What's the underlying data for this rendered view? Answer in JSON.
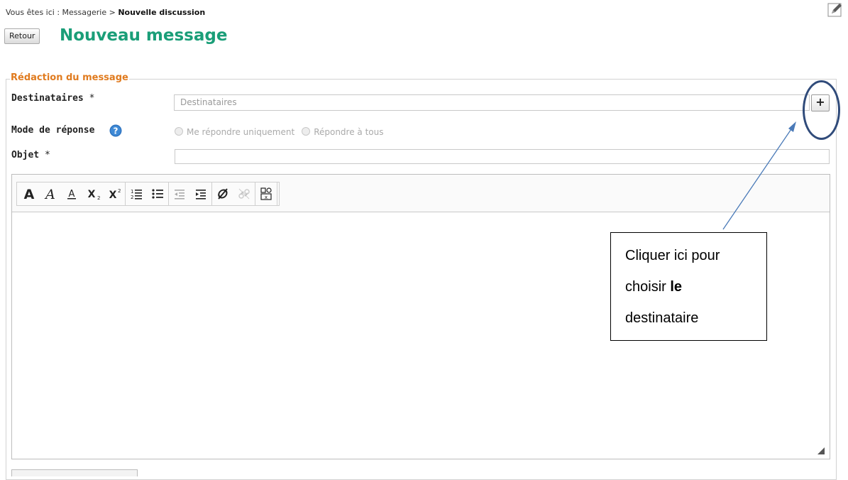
{
  "breadcrumb": {
    "prefix": "Vous êtes ici : Messagerie > ",
    "current": "Nouvelle discussion"
  },
  "header": {
    "back_label": "Retour",
    "title": "Nouveau message"
  },
  "form": {
    "legend": "Rédaction du message",
    "recipients": {
      "label": "Destinataires",
      "required": "*",
      "placeholder": "Destinataires",
      "add_label": "+"
    },
    "reply_mode": {
      "label": "Mode de réponse",
      "options": [
        "Me répondre uniquement",
        "Répondre à tous"
      ]
    },
    "subject": {
      "label": "Objet",
      "required": "*",
      "value": ""
    }
  },
  "editor": {
    "toolbar": [
      "bold",
      "italic",
      "underline",
      "subscript",
      "superscript",
      "ordered-list",
      "unordered-list",
      "outdent",
      "indent",
      "remove-format",
      "unlink",
      "insert-field"
    ]
  },
  "callout": {
    "line1": "Cliquer ici pour",
    "line2_normal": "choisir ",
    "line2_bold": "le",
    "line3": "destinataire"
  },
  "colors": {
    "title": "#1a9e78",
    "legend": "#e07b1f",
    "annotation": "#304b7a",
    "arrow": "#4a7ab8"
  }
}
